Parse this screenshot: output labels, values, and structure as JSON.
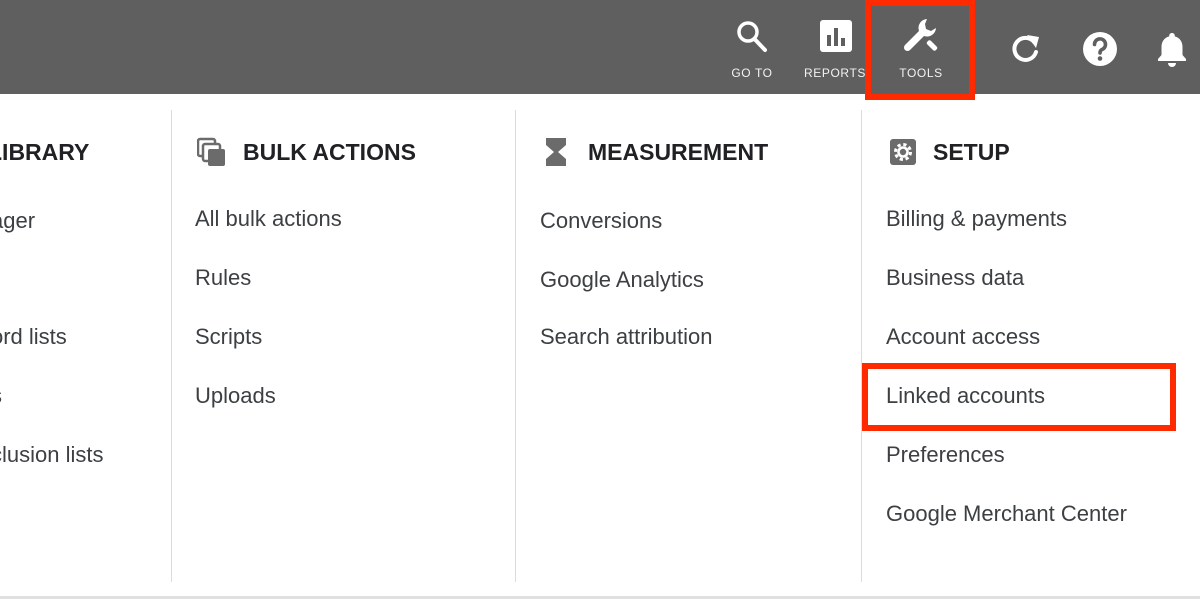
{
  "topbar": {
    "buttons": [
      {
        "label": "GO TO",
        "icon": "search-icon"
      },
      {
        "label": "REPORTS",
        "icon": "bar-chart-icon"
      },
      {
        "label": "TOOLS",
        "icon": "wrench-icon",
        "highlighted": true
      }
    ],
    "extra_icons": [
      "refresh-icon",
      "help-icon",
      "bell-icon"
    ]
  },
  "columns": [
    {
      "title": "LIBRARY",
      "items": [
        "ager",
        "ord lists",
        "s",
        "clusion lists"
      ]
    },
    {
      "title": "BULK ACTIONS",
      "icon": "copy-icon",
      "items": [
        "All bulk actions",
        "Rules",
        "Scripts",
        "Uploads"
      ]
    },
    {
      "title": "MEASUREMENT",
      "icon": "hourglass-icon",
      "items": [
        "Conversions",
        "Google Analytics",
        "Search attribution"
      ]
    },
    {
      "title": "SETUP",
      "icon": "gear-icon",
      "items": [
        "Billing & payments",
        "Business data",
        "Account access",
        "Linked accounts",
        "Preferences",
        "Google Merchant Center"
      ],
      "highlighted_item": "Linked accounts"
    }
  ],
  "colors": {
    "topbar": "#5f5f5f",
    "highlight": "#ff2a00",
    "text": "#3c4043"
  }
}
